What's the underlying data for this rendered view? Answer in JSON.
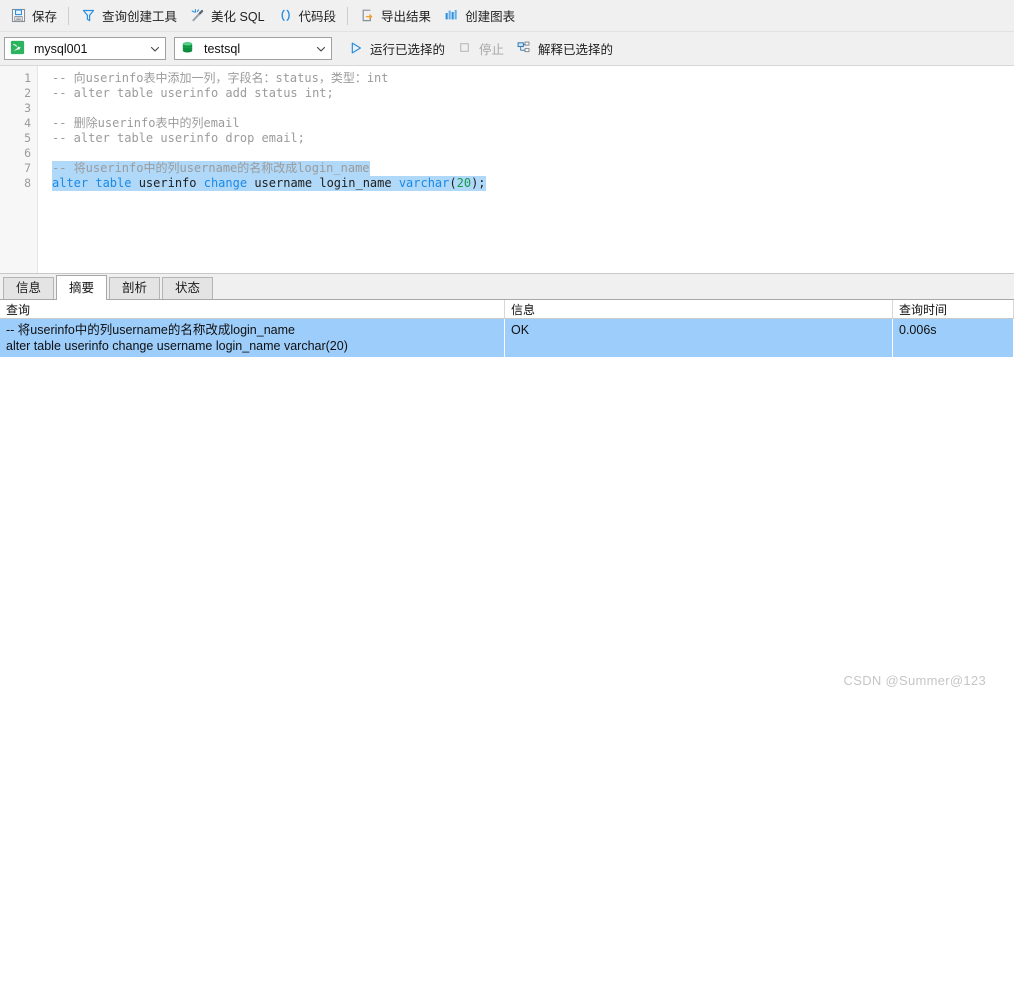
{
  "toolbar_primary": {
    "buttons": [
      {
        "label": "保存",
        "icon": "save-floppy-icon",
        "name": "save"
      },
      {
        "label": "查询创建工具",
        "icon": "query-builder-icon",
        "name": "query-builder"
      },
      {
        "label": "美化 SQL",
        "icon": "beautify-wand-icon",
        "name": "beautify-sql"
      },
      {
        "label": "代码段",
        "icon": "code-snippet-parens-icon",
        "name": "code-snippet"
      },
      {
        "label": "导出结果",
        "icon": "export-arrow-icon",
        "name": "export-result"
      },
      {
        "label": "创建图表",
        "icon": "create-chart-bars-icon",
        "name": "create-chart"
      }
    ]
  },
  "toolbar_secondary": {
    "connection": {
      "value": "mysql001",
      "icon": "mysql-dolphin-icon"
    },
    "database": {
      "value": "testsql",
      "icon": "database-cylinder-icon"
    },
    "run_selected": {
      "label": "运行已选择的",
      "icon": "play-triangle-icon"
    },
    "stop": {
      "label": "停止",
      "icon": "stop-square-icon",
      "disabled": true
    },
    "explain_selected": {
      "label": "解释已选择的",
      "icon": "explain-plan-icon"
    }
  },
  "editor": {
    "line_numbers": [
      "1",
      "2",
      "3",
      "4",
      "5",
      "6",
      "7",
      "8"
    ],
    "lines": [
      {
        "n": 1,
        "selected": false,
        "tokens": [
          {
            "t": "cm",
            "v": "-- 向userinfo表中添加一列，字段名：status，类型：int"
          }
        ]
      },
      {
        "n": 2,
        "selected": false,
        "tokens": [
          {
            "t": "cm",
            "v": "-- alter table userinfo add status int;"
          }
        ]
      },
      {
        "n": 3,
        "selected": false,
        "tokens": []
      },
      {
        "n": 4,
        "selected": false,
        "tokens": [
          {
            "t": "cm",
            "v": "-- 删除userinfo表中的列email"
          }
        ]
      },
      {
        "n": 5,
        "selected": false,
        "tokens": [
          {
            "t": "cm",
            "v": "-- alter table userinfo drop email;"
          }
        ]
      },
      {
        "n": 6,
        "selected": false,
        "tokens": []
      },
      {
        "n": 7,
        "selected": true,
        "tokens": [
          {
            "t": "cm",
            "v": "-- 将userinfo中的列username的名称改成login_name"
          }
        ]
      },
      {
        "n": 8,
        "selected": true,
        "tokens": [
          {
            "t": "kw",
            "v": "alter"
          },
          {
            "t": "id",
            "v": " "
          },
          {
            "t": "kw",
            "v": "table"
          },
          {
            "t": "id",
            "v": " userinfo "
          },
          {
            "t": "kw",
            "v": "change"
          },
          {
            "t": "id",
            "v": " username login_name "
          },
          {
            "t": "kw",
            "v": "varchar"
          },
          {
            "t": "punct",
            "v": "("
          },
          {
            "t": "num",
            "v": "20"
          },
          {
            "t": "punct",
            "v": ");"
          }
        ]
      }
    ]
  },
  "result_tabs": {
    "items": [
      {
        "label": "信息",
        "active": false
      },
      {
        "label": "摘要",
        "active": true
      },
      {
        "label": "剖析",
        "active": false
      },
      {
        "label": "状态",
        "active": false
      }
    ]
  },
  "result_grid": {
    "columns": [
      "查询",
      "信息",
      "查询时间"
    ],
    "rows": [
      {
        "query_line1": "-- 将userinfo中的列username的名称改成login_name",
        "query_line2": "alter table userinfo change username login_name varchar(20)",
        "info": "OK",
        "time": "0.006s"
      }
    ]
  },
  "watermark": {
    "text": "CSDN @Summer@123"
  },
  "colors": {
    "toolbar_bg": "#f0f0f0",
    "selection_blue": "#9dcdfa",
    "editor_selection": "#b0d8f8",
    "keyword": "#1a8ae5",
    "comment": "#9b9b9b",
    "number": "#159a4e",
    "accent_green": "#22a85a",
    "watermark": "#c6c6c6"
  }
}
